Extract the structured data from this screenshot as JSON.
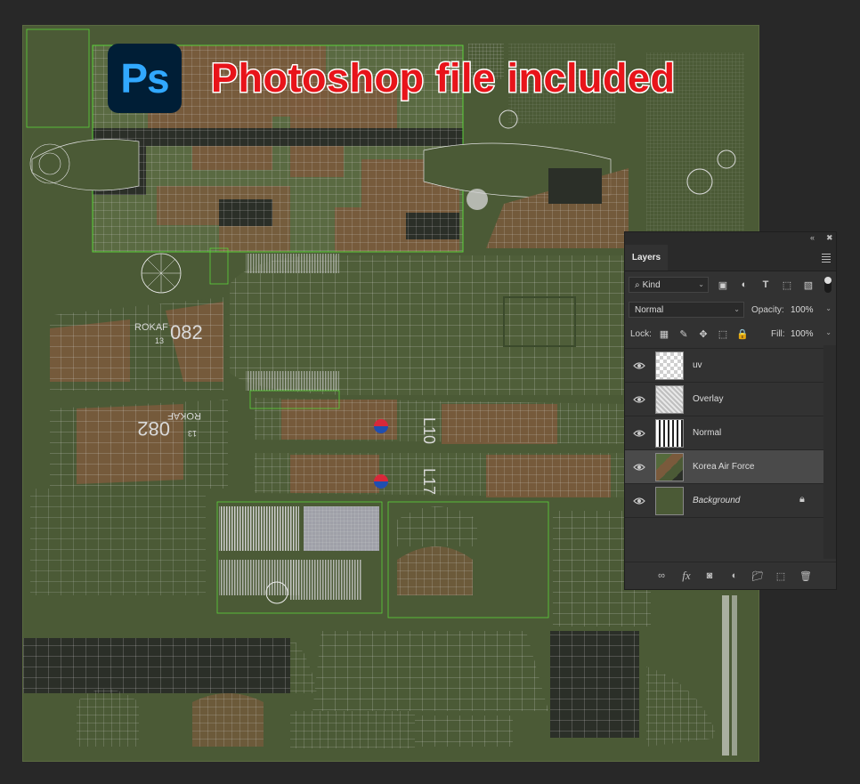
{
  "banner": {
    "ps_label": "Ps",
    "text": "Photoshop file included"
  },
  "texture_labels": {
    "rokaf_1": "ROKAF",
    "serial_1": "082",
    "num_1": "13",
    "rokaf_2": "ROKAF",
    "serial_2": "082",
    "num_2": "13",
    "code_1": "L10",
    "code_2": "L17"
  },
  "layers_panel": {
    "collapse_icon": "double-chevron-icon",
    "close_icon": "close-icon",
    "tab_label": "Layers",
    "filter": {
      "label": "Kind"
    },
    "blend_mode": "Normal",
    "opacity_label": "Opacity:",
    "opacity_value": "100%",
    "lock_label": "Lock:",
    "fill_label": "Fill:",
    "fill_value": "100%",
    "layers": [
      {
        "name": "uv",
        "visible": true,
        "thumb": "checker"
      },
      {
        "name": "Overlay",
        "visible": true,
        "thumb": "overlay"
      },
      {
        "name": "Normal",
        "visible": true,
        "thumb": "normal"
      },
      {
        "name": "Korea Air Force",
        "visible": true,
        "thumb": "camo",
        "selected": true
      },
      {
        "name": "Background",
        "visible": true,
        "thumb": "solid",
        "locked": true
      }
    ]
  },
  "colors": {
    "canvas_bg": "#4b5a36",
    "uv_line": "#d9d9d9",
    "uv_border": "#5bd23a",
    "camo_brown": "#7a5a3c",
    "camo_dark": "#2b2f28",
    "camo_green": "#556a3c",
    "panel_bg": "#323232",
    "banner_red": "#e8141a",
    "ps_blue": "#31a8ff"
  }
}
